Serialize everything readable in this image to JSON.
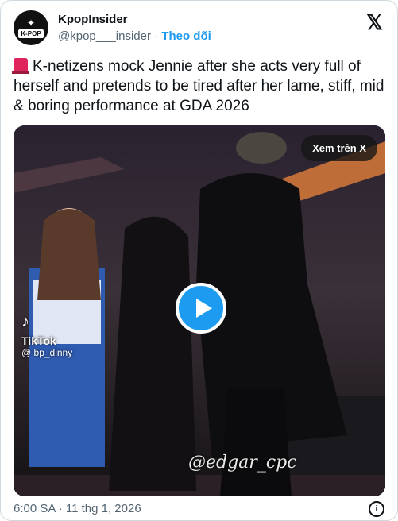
{
  "header": {
    "display_name": "KpopInsider",
    "avatar_text": "K-POP",
    "handle": "@kpop___insider",
    "separator": "·",
    "follow_label": "Theo dõi"
  },
  "tweet": {
    "text": "K-netizens mock Jennie after she acts very full of herself and pretends to be tired after her lame, stiff, mid & boring performance at GDA 2026",
    "siren_icon": "police-car-light-icon"
  },
  "media": {
    "watch_on_x_label": "Xem trên X",
    "tiktok_brand": "TikTok",
    "tiktok_handle": "@ bp_dinny",
    "watermark": "@edgar_cpc"
  },
  "footer": {
    "timestamp": "6:00 SA · 11 thg 1, 2026"
  },
  "colors": {
    "accent": "#1d9bf0",
    "text": "#0f1419",
    "muted": "#536471"
  }
}
